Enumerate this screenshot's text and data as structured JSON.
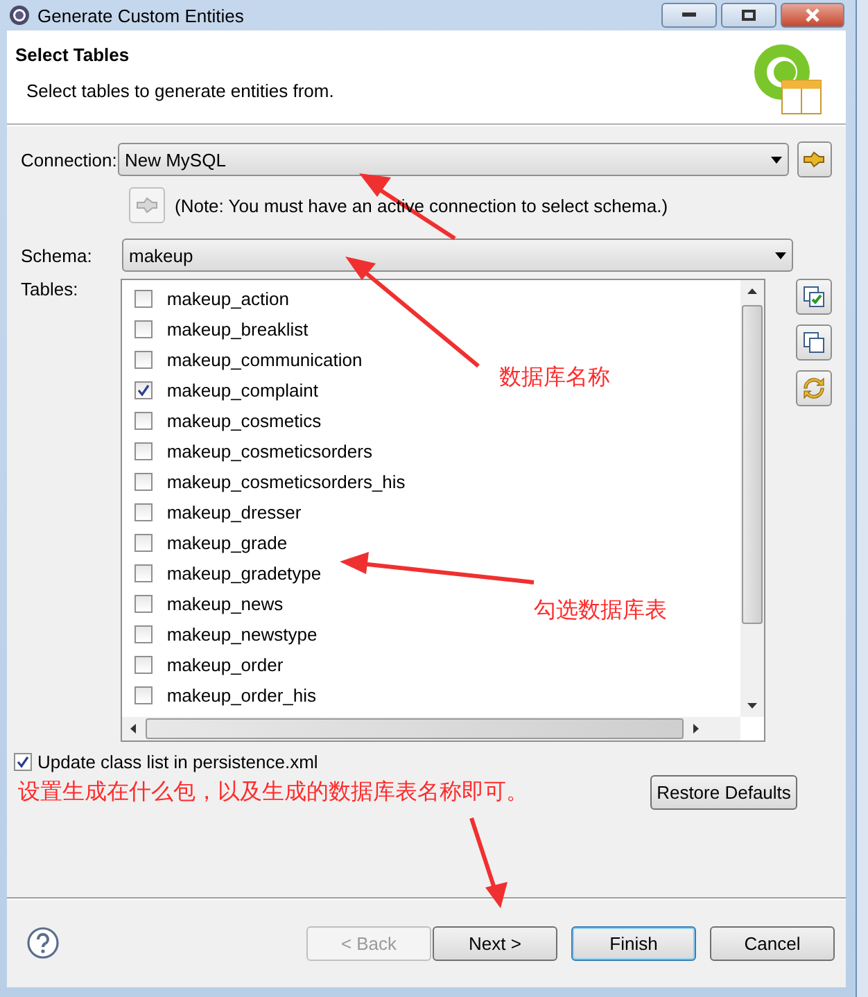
{
  "window": {
    "title": "Generate Custom Entities"
  },
  "header": {
    "title": "Select Tables",
    "description": "Select tables to generate entities from."
  },
  "connection": {
    "label": "Connection:",
    "value": "New MySQL"
  },
  "note": "(Note: You must have an active connection to select schema.)",
  "schema": {
    "label": "Schema:",
    "value": "makeup"
  },
  "tables_label": "Tables:",
  "tables": [
    {
      "name": "makeup_action",
      "checked": false
    },
    {
      "name": "makeup_breaklist",
      "checked": false
    },
    {
      "name": "makeup_communication",
      "checked": false
    },
    {
      "name": "makeup_complaint",
      "checked": true
    },
    {
      "name": "makeup_cosmetics",
      "checked": false
    },
    {
      "name": "makeup_cosmeticsorders",
      "checked": false
    },
    {
      "name": "makeup_cosmeticsorders_his",
      "checked": false
    },
    {
      "name": "makeup_dresser",
      "checked": false
    },
    {
      "name": "makeup_grade",
      "checked": false
    },
    {
      "name": "makeup_gradetype",
      "checked": false
    },
    {
      "name": "makeup_news",
      "checked": false
    },
    {
      "name": "makeup_newstype",
      "checked": false
    },
    {
      "name": "makeup_order",
      "checked": false
    },
    {
      "name": "makeup_order_his",
      "checked": false
    }
  ],
  "update_class_list": {
    "label": "Update class list in persistence.xml",
    "checked": true
  },
  "restore_defaults": "Restore Defaults",
  "annotations": [
    "数据库名称",
    "勾选数据库表",
    "设置生成在什么包，以及生成的数据库表名称即可。"
  ],
  "buttons": [
    {
      "label": "< Back",
      "disabled": true,
      "default": false
    },
    {
      "label": "Next >",
      "disabled": false,
      "default": false
    },
    {
      "label": "Finish",
      "disabled": false,
      "default": true
    },
    {
      "label": "Cancel",
      "disabled": false,
      "default": false
    }
  ]
}
